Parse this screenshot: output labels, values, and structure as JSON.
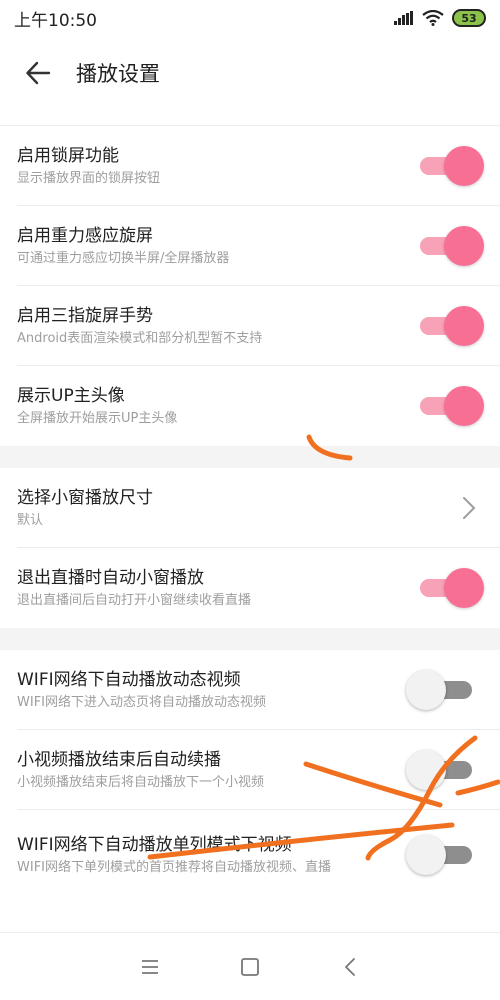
{
  "status_bar": {
    "time": "上午10:50",
    "battery": "53"
  },
  "app_bar": {
    "title": "播放设置"
  },
  "sections": [
    {
      "items": [
        {
          "title": "启用锁屏功能",
          "subtitle": "显示播放界面的锁屏按钮",
          "type": "toggle",
          "state": "on"
        },
        {
          "title": "启用重力感应旋屏",
          "subtitle": "可通过重力感应切换半屏/全屏播放器",
          "type": "toggle",
          "state": "on"
        },
        {
          "title": "启用三指旋屏手势",
          "subtitle": "Android表面渲染模式和部分机型暂不支持",
          "type": "toggle",
          "state": "on"
        },
        {
          "title": "展示UP主头像",
          "subtitle": "全屏播放开始展示UP主头像",
          "type": "toggle",
          "state": "on"
        }
      ]
    },
    {
      "items": [
        {
          "title": "选择小窗播放尺寸",
          "subtitle": "默认",
          "type": "chevron"
        },
        {
          "title": "退出直播时自动小窗播放",
          "subtitle": "退出直播间后自动打开小窗继续收看直播",
          "type": "toggle",
          "state": "on"
        }
      ]
    },
    {
      "items": [
        {
          "title": "WIFI网络下自动播放动态视频",
          "subtitle": "WIFI网络下进入动态页将自动播放动态视频",
          "type": "toggle",
          "state": "off"
        },
        {
          "title": "小视频播放结束后自动续播",
          "subtitle": "小视频播放结束后将自动播放下一个小视频",
          "type": "toggle",
          "state": "off"
        },
        {
          "title": "WIFI网络下自动播放单列模式下视频",
          "subtitle": "WIFI网络下单列模式的首页推荐将自动播放视频、直播",
          "type": "toggle",
          "state": "off"
        }
      ]
    }
  ],
  "colors": {
    "accent": "#f86f94",
    "accent_track": "#f8a2b8",
    "scribble": "#f07020"
  }
}
